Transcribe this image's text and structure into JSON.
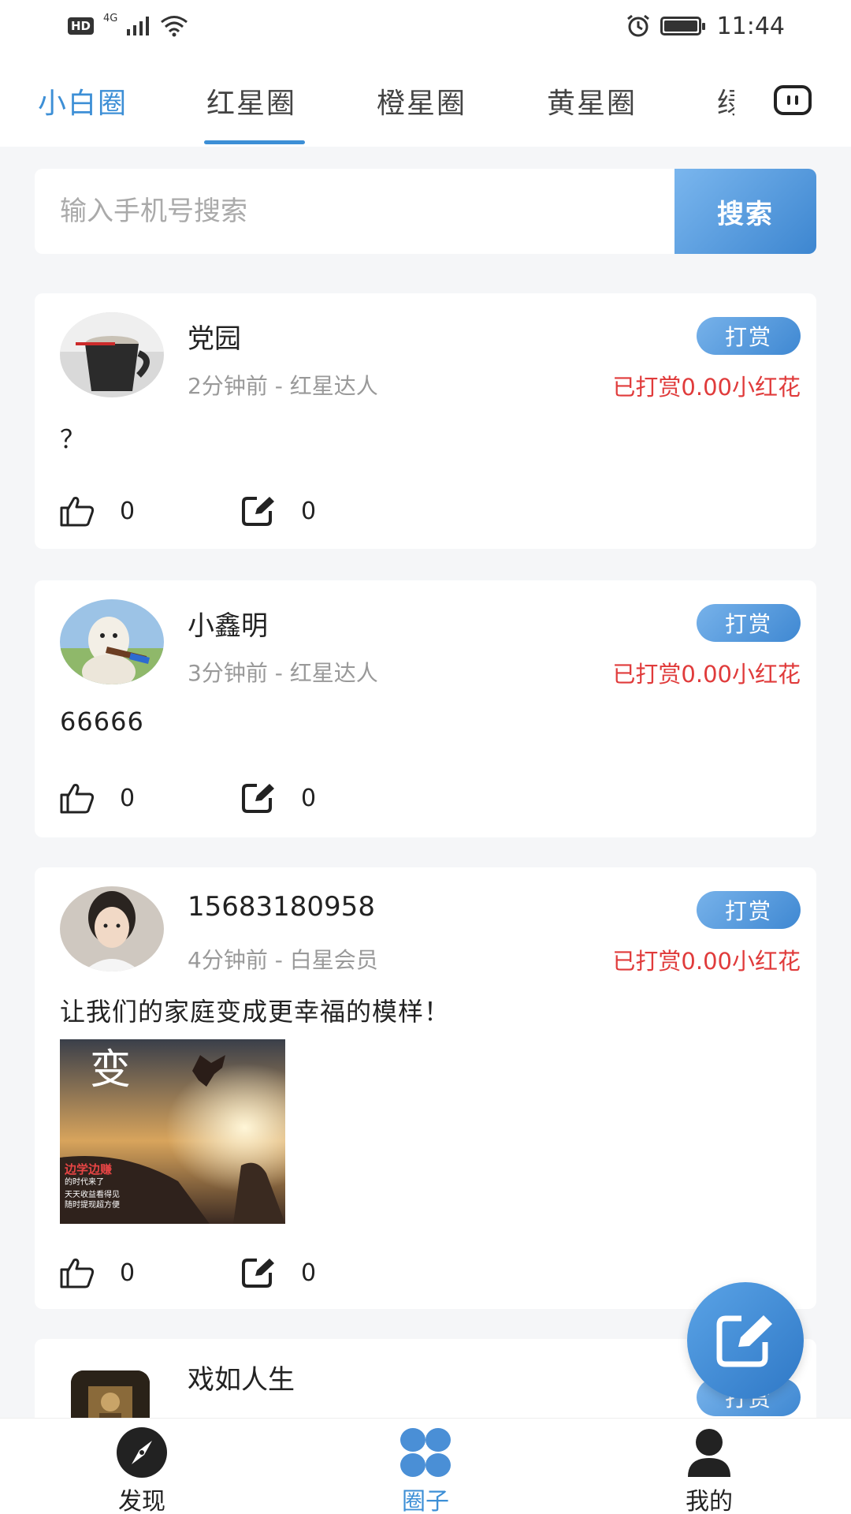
{
  "status_bar": {
    "hd": "HD",
    "network": "4G",
    "time": "11:44"
  },
  "tabs": [
    {
      "label": "小白圈"
    },
    {
      "label": "红星圈"
    },
    {
      "label": "橙星圈"
    },
    {
      "label": "黄星圈"
    },
    {
      "label": "绿"
    }
  ],
  "search": {
    "placeholder": "输入手机号搜索",
    "button_label": "搜索"
  },
  "posts": [
    {
      "username": "党园",
      "meta": "2分钟前 - 红星达人",
      "reward_button": "打赏",
      "reward_status": "已打赏0.00小红花",
      "content": "？",
      "likes": "0",
      "comments": "0"
    },
    {
      "username": "小鑫明",
      "meta": "3分钟前 - 红星达人",
      "reward_button": "打赏",
      "reward_status": "已打赏0.00小红花",
      "content": "66666",
      "likes": "0",
      "comments": "0"
    },
    {
      "username": "15683180958",
      "meta": "4分钟前 - 白星会员",
      "reward_button": "打赏",
      "reward_status": "已打赏0.00小红花",
      "content": "让我们的家庭变成更幸福的模样！",
      "image_text": {
        "title": "变",
        "line1": "边学边赚",
        "line2": "的时代来了",
        "line3": "天天收益看得见",
        "line4": "随时提现超方便"
      },
      "likes": "0",
      "comments": "0"
    },
    {
      "username": "戏如人生",
      "reward_button": "打赏"
    }
  ],
  "bottom_nav": [
    {
      "label": "发现"
    },
    {
      "label": "圈子"
    },
    {
      "label": "我的"
    }
  ],
  "colors": {
    "accent": "#3d8fd6",
    "reward_text": "#e03b3b"
  }
}
